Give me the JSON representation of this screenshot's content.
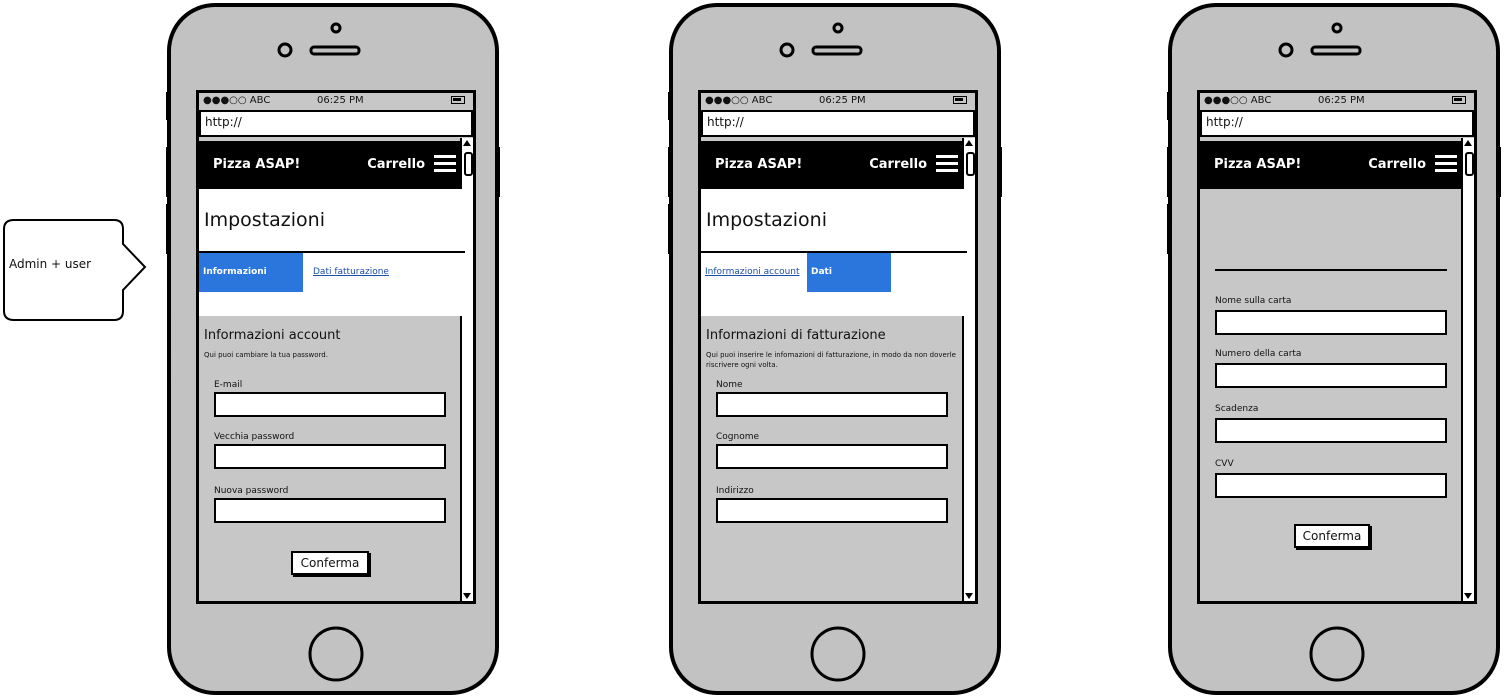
{
  "callout": {
    "text": "Admin + user"
  },
  "phones": [
    {
      "status": {
        "signal": "●●●○○ ABC",
        "time": "06:25 PM"
      },
      "url": "http://",
      "navbar": {
        "brand": "Pizza ASAP!",
        "cart": "Carrello"
      },
      "header": "Impostazioni",
      "tabs": [
        {
          "label": "Informazioni account",
          "active": true
        },
        {
          "label": "Dati fatturazione",
          "active": false
        }
      ],
      "section": {
        "title": "Informazioni account",
        "description": "Qui puoi cambiare la tua password."
      },
      "fields": [
        "E-mail",
        "Vecchia password",
        "Nuova password"
      ],
      "button": "Conferma"
    },
    {
      "status": {
        "signal": "●●●○○ ABC",
        "time": "06:25 PM"
      },
      "url": "http://",
      "navbar": {
        "brand": "Pizza ASAP!",
        "cart": "Carrello"
      },
      "header": "Impostazioni",
      "tabs": [
        {
          "label": "Informazioni account",
          "active": false
        },
        {
          "label": "Dati fatturazione",
          "active": true
        }
      ],
      "section": {
        "title": "Informazioni di fatturazione",
        "description": "Qui puoi inserire le infomazioni di fatturazione, in modo da non doverle riscrivere ogni volta."
      },
      "fields": [
        "Nome",
        "Cognome",
        "Indirizzo"
      ]
    },
    {
      "status": {
        "signal": "●●●○○ ABC",
        "time": "06:25 PM"
      },
      "url": "http://",
      "navbar": {
        "brand": "Pizza ASAP!",
        "cart": "Carrello"
      },
      "fields": [
        "Nome sulla carta",
        "Numero della carta",
        "Scadenza",
        "CVV"
      ],
      "button": "Conferma"
    }
  ]
}
